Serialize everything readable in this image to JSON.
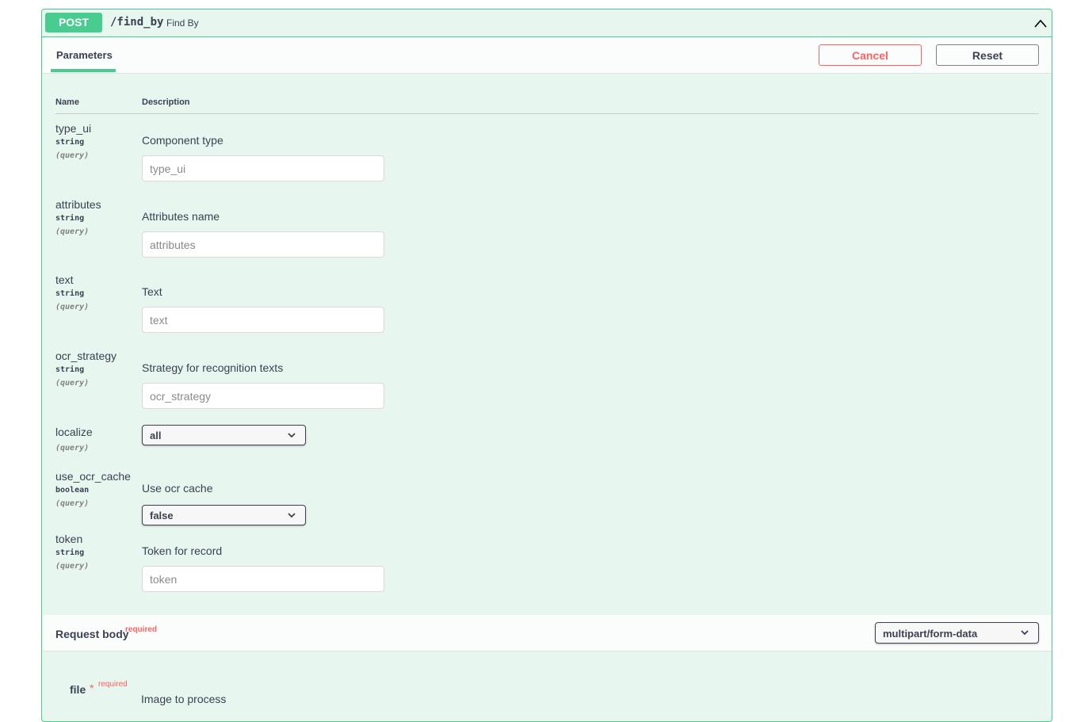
{
  "operation": {
    "method": "POST",
    "path": "/find_by",
    "summary": "Find By",
    "collapse_icon": "chevron-up-icon"
  },
  "params_section": {
    "tab_label": "Parameters",
    "cancel_label": "Cancel",
    "reset_label": "Reset",
    "col_name": "Name",
    "col_description": "Description"
  },
  "parameters": [
    {
      "name": "type_ui",
      "type": "string",
      "in": "(query)",
      "description": "Component type",
      "placeholder": "type_ui"
    },
    {
      "name": "attributes",
      "type": "string",
      "in": "(query)",
      "description": "Attributes name",
      "placeholder": "attributes"
    },
    {
      "name": "text",
      "type": "string",
      "in": "(query)",
      "description": "Text",
      "placeholder": "text"
    },
    {
      "name": "ocr_strategy",
      "type": "string",
      "in": "(query)",
      "description": "Strategy for recognition texts",
      "placeholder": "ocr_strategy"
    },
    {
      "name": "localize",
      "type": "",
      "in": "(query)",
      "description": "",
      "selected": "all"
    },
    {
      "name": "use_ocr_cache",
      "type": "boolean",
      "in": "(query)",
      "description": "Use ocr cache",
      "selected": "false"
    },
    {
      "name": "token",
      "type": "string",
      "in": "(query)",
      "description": "Token for record",
      "placeholder": "token"
    }
  ],
  "request_body": {
    "title": "Request body",
    "required_label": "required",
    "content_type": "multipart/form-data",
    "field": {
      "name": "file",
      "required_mark": "*",
      "required_label": "required",
      "description": "Image to process"
    }
  },
  "colors": {
    "post_accent": "#49cc90",
    "block_background": "#e8f6f0",
    "required": "#ff6060"
  }
}
